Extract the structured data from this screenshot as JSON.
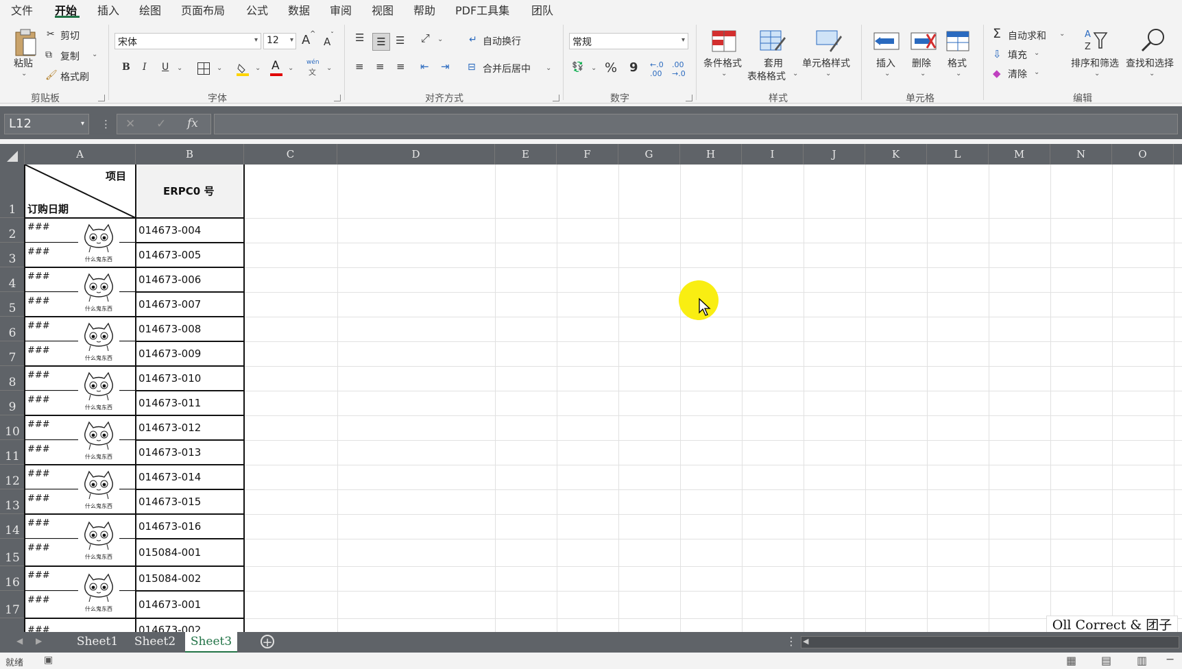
{
  "menu": {
    "items": [
      "文件",
      "开始",
      "插入",
      "绘图",
      "页面布局",
      "公式",
      "数据",
      "审阅",
      "视图",
      "帮助",
      "PDF工具集",
      "团队"
    ],
    "active_index": 1
  },
  "ribbon": {
    "clipboard": {
      "paste": "粘贴",
      "cut": "剪切",
      "copy": "复制",
      "format_painter": "格式刷",
      "label": "剪贴板"
    },
    "font": {
      "name": "宋体",
      "size": "12",
      "bold": "B",
      "italic": "I",
      "underline": "U",
      "wen": "wén",
      "wen_char": "文",
      "grow": "A",
      "shrink": "A",
      "font_color_glyph": "A",
      "label": "字体"
    },
    "alignment": {
      "wrap": "自动换行",
      "merge": "合并后居中",
      "label": "对齐方式"
    },
    "number": {
      "format": "常规",
      "percent": "%",
      "comma": "9",
      "label": "数字"
    },
    "styles": {
      "conditional": "条件格式",
      "table_line1": "套用",
      "table_line2": "表格格式",
      "cell_styles": "单元格样式",
      "label": "样式"
    },
    "cells": {
      "insert": "插入",
      "delete": "删除",
      "format": "格式",
      "label": "单元格"
    },
    "editing": {
      "autosum": "自动求和",
      "fill": "填充",
      "clear": "清除",
      "sort": "排序和筛选",
      "find": "查找和选择",
      "label": "编辑"
    }
  },
  "formula_bar": {
    "name_box": "L12",
    "fx": "fx",
    "cancel": "✕",
    "enter": "✓",
    "formula": ""
  },
  "columns": [
    "A",
    "B",
    "C",
    "D",
    "E",
    "F",
    "G",
    "H",
    "I",
    "J",
    "K",
    "L",
    "M",
    "N",
    "O"
  ],
  "rows": [
    "1",
    "2",
    "3",
    "4",
    "5",
    "6",
    "7",
    "8",
    "9",
    "10",
    "11",
    "12",
    "13",
    "14",
    "15",
    "16",
    "17"
  ],
  "sheet": {
    "header_top_right": "项目",
    "header_bottom_left": "订购日期",
    "header_b": "ERPC0 号",
    "hash": "###",
    "erp_numbers": [
      "014673-004",
      "014673-005",
      "014673-006",
      "014673-007",
      "014673-008",
      "014673-009",
      "014673-010",
      "014673-011",
      "014673-012",
      "014673-013",
      "014673-014",
      "014673-015",
      "014673-016",
      "015084-001",
      "015084-002",
      "014673-001"
    ],
    "partial_row": {
      "a": "###",
      "b": "014673-002"
    },
    "sticker_caption": "什么鬼东西"
  },
  "tabs": [
    "Sheet1",
    "Sheet2",
    "Sheet3"
  ],
  "active_tab": "Sheet3",
  "status": {
    "ready": "就绪"
  },
  "watermark": "Oll Correct & 团子",
  "colors": {
    "accent": "#217346",
    "cursor_highlight": "#f9ee12",
    "header_bg": "#5f6368"
  }
}
